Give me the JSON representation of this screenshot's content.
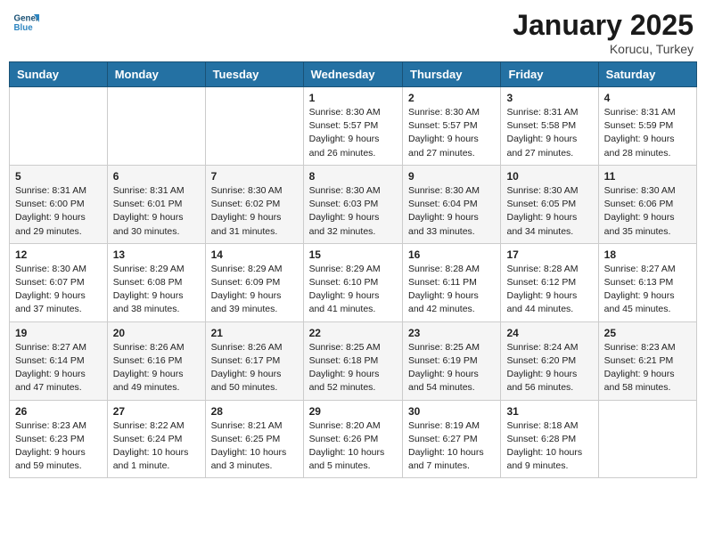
{
  "header": {
    "logo_general": "General",
    "logo_blue": "Blue",
    "month_year": "January 2025",
    "location": "Korucu, Turkey"
  },
  "weekdays": [
    "Sunday",
    "Monday",
    "Tuesday",
    "Wednesday",
    "Thursday",
    "Friday",
    "Saturday"
  ],
  "weeks": [
    [
      {
        "day": "",
        "info": ""
      },
      {
        "day": "",
        "info": ""
      },
      {
        "day": "",
        "info": ""
      },
      {
        "day": "1",
        "info": "Sunrise: 8:30 AM\nSunset: 5:57 PM\nDaylight: 9 hours\nand 26 minutes."
      },
      {
        "day": "2",
        "info": "Sunrise: 8:30 AM\nSunset: 5:57 PM\nDaylight: 9 hours\nand 27 minutes."
      },
      {
        "day": "3",
        "info": "Sunrise: 8:31 AM\nSunset: 5:58 PM\nDaylight: 9 hours\nand 27 minutes."
      },
      {
        "day": "4",
        "info": "Sunrise: 8:31 AM\nSunset: 5:59 PM\nDaylight: 9 hours\nand 28 minutes."
      }
    ],
    [
      {
        "day": "5",
        "info": "Sunrise: 8:31 AM\nSunset: 6:00 PM\nDaylight: 9 hours\nand 29 minutes."
      },
      {
        "day": "6",
        "info": "Sunrise: 8:31 AM\nSunset: 6:01 PM\nDaylight: 9 hours\nand 30 minutes."
      },
      {
        "day": "7",
        "info": "Sunrise: 8:30 AM\nSunset: 6:02 PM\nDaylight: 9 hours\nand 31 minutes."
      },
      {
        "day": "8",
        "info": "Sunrise: 8:30 AM\nSunset: 6:03 PM\nDaylight: 9 hours\nand 32 minutes."
      },
      {
        "day": "9",
        "info": "Sunrise: 8:30 AM\nSunset: 6:04 PM\nDaylight: 9 hours\nand 33 minutes."
      },
      {
        "day": "10",
        "info": "Sunrise: 8:30 AM\nSunset: 6:05 PM\nDaylight: 9 hours\nand 34 minutes."
      },
      {
        "day": "11",
        "info": "Sunrise: 8:30 AM\nSunset: 6:06 PM\nDaylight: 9 hours\nand 35 minutes."
      }
    ],
    [
      {
        "day": "12",
        "info": "Sunrise: 8:30 AM\nSunset: 6:07 PM\nDaylight: 9 hours\nand 37 minutes."
      },
      {
        "day": "13",
        "info": "Sunrise: 8:29 AM\nSunset: 6:08 PM\nDaylight: 9 hours\nand 38 minutes."
      },
      {
        "day": "14",
        "info": "Sunrise: 8:29 AM\nSunset: 6:09 PM\nDaylight: 9 hours\nand 39 minutes."
      },
      {
        "day": "15",
        "info": "Sunrise: 8:29 AM\nSunset: 6:10 PM\nDaylight: 9 hours\nand 41 minutes."
      },
      {
        "day": "16",
        "info": "Sunrise: 8:28 AM\nSunset: 6:11 PM\nDaylight: 9 hours\nand 42 minutes."
      },
      {
        "day": "17",
        "info": "Sunrise: 8:28 AM\nSunset: 6:12 PM\nDaylight: 9 hours\nand 44 minutes."
      },
      {
        "day": "18",
        "info": "Sunrise: 8:27 AM\nSunset: 6:13 PM\nDaylight: 9 hours\nand 45 minutes."
      }
    ],
    [
      {
        "day": "19",
        "info": "Sunrise: 8:27 AM\nSunset: 6:14 PM\nDaylight: 9 hours\nand 47 minutes."
      },
      {
        "day": "20",
        "info": "Sunrise: 8:26 AM\nSunset: 6:16 PM\nDaylight: 9 hours\nand 49 minutes."
      },
      {
        "day": "21",
        "info": "Sunrise: 8:26 AM\nSunset: 6:17 PM\nDaylight: 9 hours\nand 50 minutes."
      },
      {
        "day": "22",
        "info": "Sunrise: 8:25 AM\nSunset: 6:18 PM\nDaylight: 9 hours\nand 52 minutes."
      },
      {
        "day": "23",
        "info": "Sunrise: 8:25 AM\nSunset: 6:19 PM\nDaylight: 9 hours\nand 54 minutes."
      },
      {
        "day": "24",
        "info": "Sunrise: 8:24 AM\nSunset: 6:20 PM\nDaylight: 9 hours\nand 56 minutes."
      },
      {
        "day": "25",
        "info": "Sunrise: 8:23 AM\nSunset: 6:21 PM\nDaylight: 9 hours\nand 58 minutes."
      }
    ],
    [
      {
        "day": "26",
        "info": "Sunrise: 8:23 AM\nSunset: 6:23 PM\nDaylight: 9 hours\nand 59 minutes."
      },
      {
        "day": "27",
        "info": "Sunrise: 8:22 AM\nSunset: 6:24 PM\nDaylight: 10 hours\nand 1 minute."
      },
      {
        "day": "28",
        "info": "Sunrise: 8:21 AM\nSunset: 6:25 PM\nDaylight: 10 hours\nand 3 minutes."
      },
      {
        "day": "29",
        "info": "Sunrise: 8:20 AM\nSunset: 6:26 PM\nDaylight: 10 hours\nand 5 minutes."
      },
      {
        "day": "30",
        "info": "Sunrise: 8:19 AM\nSunset: 6:27 PM\nDaylight: 10 hours\nand 7 minutes."
      },
      {
        "day": "31",
        "info": "Sunrise: 8:18 AM\nSunset: 6:28 PM\nDaylight: 10 hours\nand 9 minutes."
      },
      {
        "day": "",
        "info": ""
      }
    ]
  ]
}
